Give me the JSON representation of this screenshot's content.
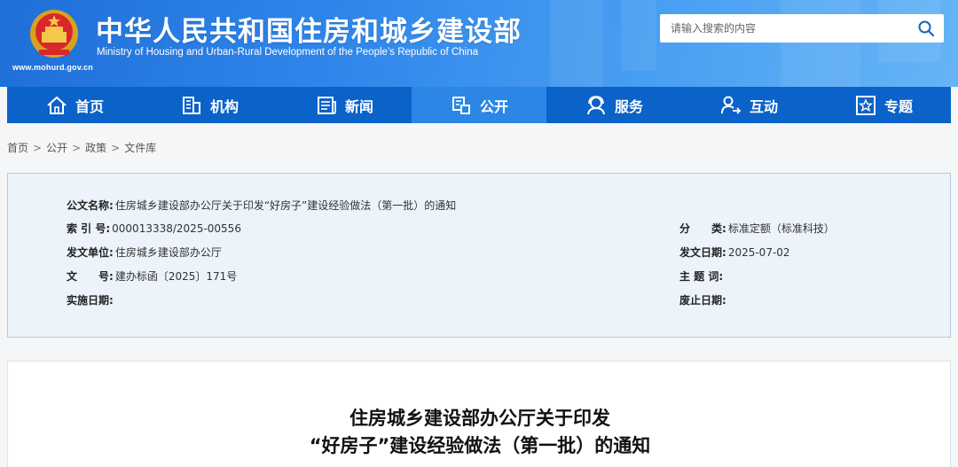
{
  "header": {
    "title_cn": "中华人民共和国住房和城乡建设部",
    "title_en": "Ministry of Housing and Urban-Rural Development of the People’s Republic of China",
    "url": "www.mohurd.gov.cn",
    "emblem_icon": "national-emblem-icon"
  },
  "search": {
    "placeholder": "请输入搜索的内容",
    "button_icon": "search-icon"
  },
  "nav": {
    "items": [
      {
        "label": "首页",
        "icon": "home-icon"
      },
      {
        "label": "机构",
        "icon": "building-icon"
      },
      {
        "label": "新闻",
        "icon": "newspaper-icon"
      },
      {
        "label": "公开",
        "icon": "disclosure-icon"
      },
      {
        "label": "服务",
        "icon": "service-icon"
      },
      {
        "label": "互动",
        "icon": "interaction-icon"
      },
      {
        "label": "专题",
        "icon": "topic-star-icon"
      }
    ],
    "active_index": 3
  },
  "breadcrumb": {
    "items": [
      "首页",
      "公开",
      "政策",
      "文件库"
    ],
    "separator": ">"
  },
  "meta": {
    "doc_name_label": "公文名称:",
    "doc_name": "住房城乡建设部办公厅关于印发“好房子”建设经验做法（第一批）的通知",
    "index_label": "索 引 号:",
    "index_no": "000013338/2025-00556",
    "category_label": "分　　类:",
    "category": "标准定额（标准科技）",
    "issuer_label": "发文单位:",
    "issuer": "住房城乡建设部办公厅",
    "date_label": "发文日期:",
    "date": "2025-07-02",
    "doc_no_label": "文　　号:",
    "doc_no": "建办标函〔2025〕171号",
    "keywords_label": "主 题 词:",
    "keywords": "",
    "effective_label": "实施日期:",
    "effective": "",
    "abolish_label": "废止日期:",
    "abolish": ""
  },
  "article": {
    "title_line1": "住房城乡建设部办公厅关于印发",
    "title_line2": "“好房子”建设经验做法（第一批）的通知"
  },
  "colors": {
    "header_blue": "#2f86ea",
    "nav_blue": "#0b62c8",
    "nav_active": "#2b86e6",
    "meta_bg": "#ecf3fa"
  }
}
